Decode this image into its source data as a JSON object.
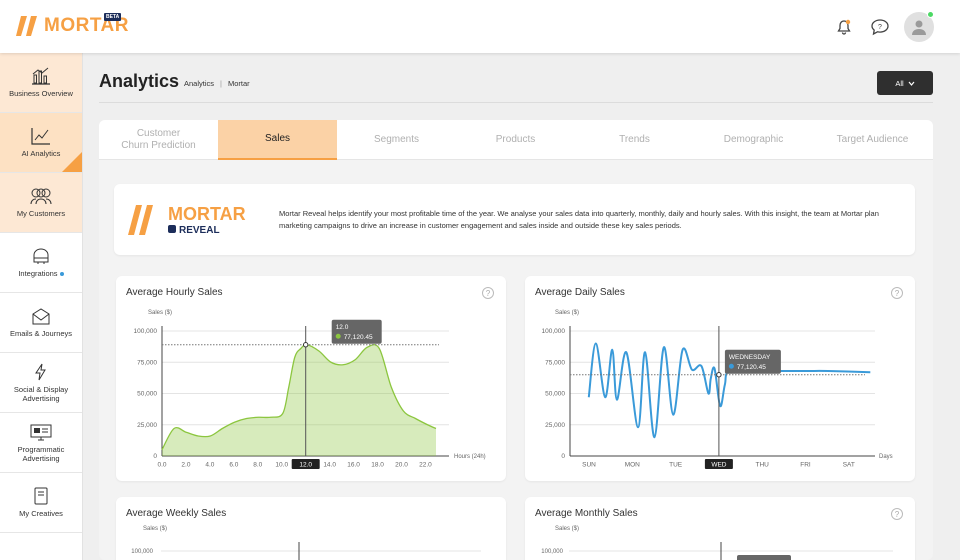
{
  "app": {
    "brand": "MORTAR",
    "beta": "BETA"
  },
  "colors": {
    "accent": "#f6a044",
    "hourly_line": "#8cc63f",
    "daily_line": "#3a9ad9"
  },
  "sidebar": {
    "items": [
      {
        "label": "Business Overview",
        "icon": "bar-chart-icon",
        "state": "hl"
      },
      {
        "label": "AI Analytics",
        "icon": "line-chart-icon",
        "state": "active"
      },
      {
        "label": "My Customers",
        "icon": "customers-icon",
        "state": "hl"
      },
      {
        "label": "Integrations",
        "icon": "integrations-icon",
        "state": "",
        "dot": true
      },
      {
        "label": "Emails & Journeys",
        "icon": "email-icon",
        "state": ""
      },
      {
        "label": "Social & Display Advertising",
        "icon": "lightning-icon",
        "state": ""
      },
      {
        "label": "Programmatic Advertising",
        "icon": "monitor-icon",
        "state": ""
      },
      {
        "label": "My Creatives",
        "icon": "document-icon",
        "state": ""
      }
    ]
  },
  "header": {
    "title": "Analytics",
    "breadcrumb": [
      "Analytics",
      "Mortar"
    ],
    "filter": "All"
  },
  "tabs": [
    {
      "label": "Customer\nChurn Prediction",
      "active": false
    },
    {
      "label": "Sales",
      "active": true
    },
    {
      "label": "Segments",
      "active": false
    },
    {
      "label": "Products",
      "active": false
    },
    {
      "label": "Trends",
      "active": false
    },
    {
      "label": "Demographic",
      "active": false
    },
    {
      "label": "Target Audience",
      "active": false
    }
  ],
  "reveal": {
    "brand": "MORTAR",
    "sub": "REVEAL",
    "text": "Mortar Reveal helps identify your most profitable time of the year. We analyse your sales data into quarterly, monthly, daily and hourly sales. With this insight, the team at Mortar plan marketing campaigns to drive an increase in customer engagement and sales inside and outside these key sales periods."
  },
  "cards": {
    "weekly_title": "Average Weekly Sales",
    "monthly_title": "Average Monthly Sales"
  },
  "chart_data": [
    {
      "type": "area",
      "title": "Average Hourly Sales",
      "ylabel": "Sales ($)",
      "xlabel": "Hours (24h)",
      "ylim": [
        0,
        100000
      ],
      "yticks": [
        "0",
        "25,000",
        "50,000",
        "75,000",
        "100,000"
      ],
      "xticks": [
        "0.0",
        "2.0",
        "4.0",
        "6.0",
        "8.0",
        "10.0",
        "12.0",
        "14.0",
        "16.0",
        "18.0",
        "20.0",
        "22.0"
      ],
      "x": [
        0,
        1,
        2,
        3,
        4,
        5,
        6,
        7,
        8,
        9,
        10,
        10.5,
        11,
        11.5,
        12,
        13,
        14,
        15,
        16,
        17,
        18,
        19,
        20,
        21,
        22,
        22.7
      ],
      "y": [
        5000,
        22000,
        19000,
        16000,
        16000,
        22000,
        27000,
        30000,
        31000,
        31000,
        34000,
        55000,
        79000,
        86000,
        89000,
        84000,
        75000,
        73000,
        77000,
        87000,
        86000,
        55000,
        36000,
        30000,
        25000,
        22000
      ],
      "tooltip": {
        "title": "12.0",
        "value": "77,120.45"
      },
      "highlight": "12.0",
      "ref_y": 89000
    },
    {
      "type": "line",
      "title": "Average Daily Sales",
      "ylabel": "Sales ($)",
      "xlabel": "Days",
      "ylim": [
        0,
        100000
      ],
      "yticks": [
        "0",
        "25,000",
        "50,000",
        "75,000",
        "100,000"
      ],
      "xticks": [
        "SUN",
        "MON",
        "TUE",
        "WED",
        "THU",
        "FRI",
        "SAT"
      ],
      "x": [
        0.4,
        0.55,
        0.75,
        0.9,
        1,
        1.2,
        1.45,
        1.6,
        1.8,
        2,
        2.2,
        2.4,
        2.6,
        2.8,
        2.95,
        3,
        3.08,
        3.2,
        3.3,
        3.4,
        4,
        5,
        5.5,
        6.4
      ],
      "y": [
        47000,
        90000,
        47000,
        85000,
        45000,
        83000,
        23000,
        83000,
        15000,
        87000,
        33000,
        85000,
        69000,
        72000,
        50000,
        62000,
        70000,
        40000,
        57000,
        68000,
        68000,
        68000,
        68000,
        67000
      ],
      "tooltip": {
        "title": "WEDNESDAY",
        "value": "77,120.45"
      },
      "highlight": "WED",
      "ref_y": 65000
    }
  ]
}
